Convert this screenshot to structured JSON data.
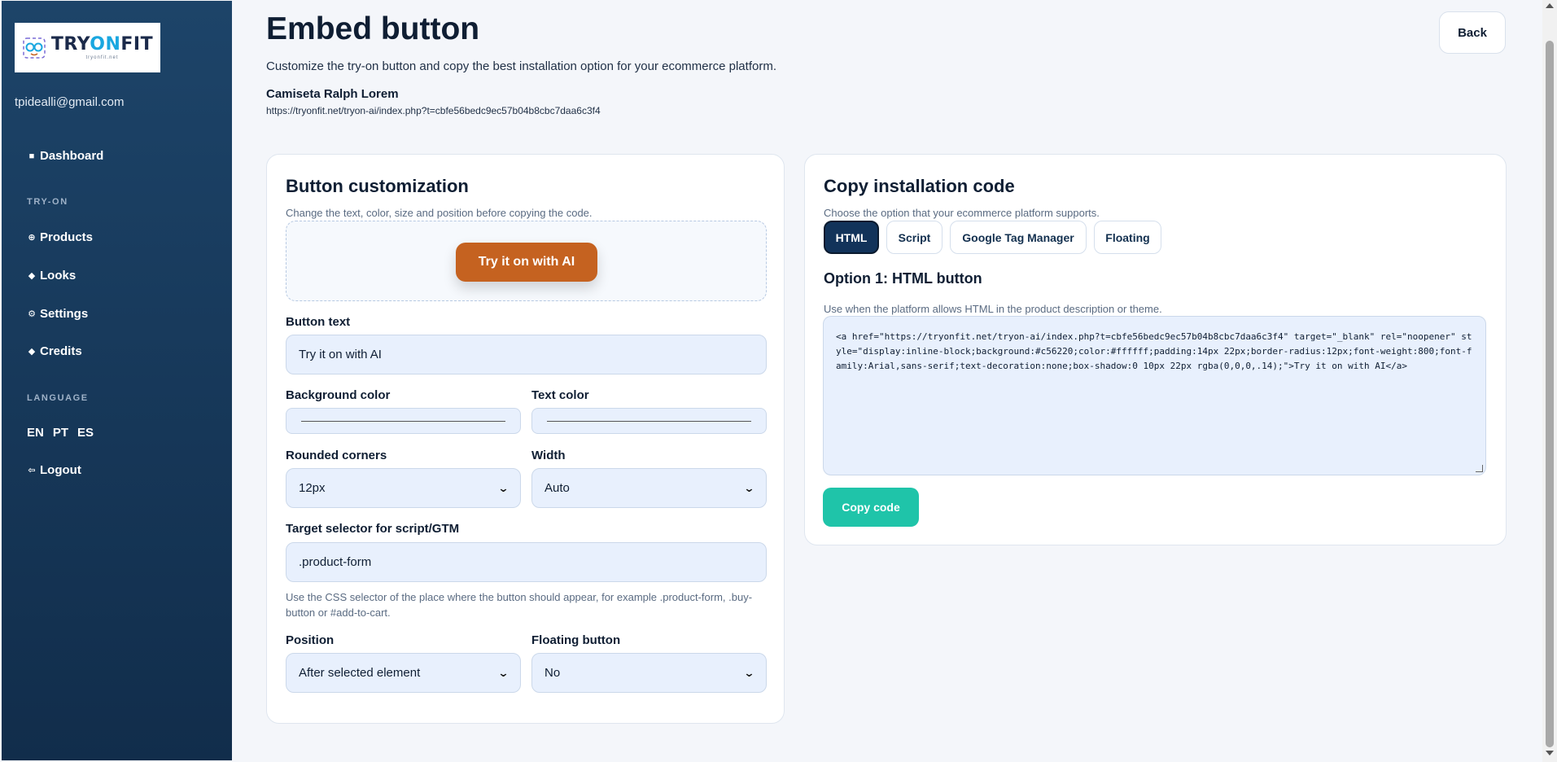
{
  "sidebar": {
    "logo": {
      "brand_part1": "TRY",
      "brand_part2": "ON",
      "brand_part3": "FIT",
      "tagline": "tryonfit.net"
    },
    "email": "tpidealli@gmail.com",
    "dashboard": {
      "icon": "■",
      "label": "Dashboard"
    },
    "tryon_section": "TRY-ON",
    "items": [
      {
        "icon": "⊕",
        "label": "Products"
      },
      {
        "icon": "◆",
        "label": "Looks"
      },
      {
        "icon": "⚙",
        "label": "Settings"
      },
      {
        "icon": "◆",
        "label": "Credits"
      }
    ],
    "language_section": "LANGUAGE",
    "languages": [
      "EN",
      "PT",
      "ES"
    ],
    "logout": {
      "icon": "⇦",
      "label": "Logout"
    }
  },
  "header": {
    "title": "Embed button",
    "subtitle": "Customize the try-on button and copy the best installation option for your ecommerce platform.",
    "product_name": "Camiseta Ralph Lorem",
    "product_url": "https://tryonfit.net/tryon-ai/index.php?t=cbfe56bedc9ec57b04b8cbc7daa6c3f4",
    "back_label": "Back"
  },
  "customization": {
    "title": "Button customization",
    "hint": "Change the text, color, size and position before copying the code.",
    "preview_button": "Try it on with AI",
    "button_text_label": "Button text",
    "button_text_value": "Try it on with AI",
    "bg_color_label": "Background color",
    "text_color_label": "Text color",
    "rounded_label": "Rounded corners",
    "rounded_value": "12px",
    "width_label": "Width",
    "width_value": "Auto",
    "selector_label": "Target selector for script/GTM",
    "selector_value": ".product-form",
    "selector_help": "Use the CSS selector of the place where the button should appear, for example .product-form, .buy-button or #add-to-cart.",
    "position_label": "Position",
    "position_value": "After selected element",
    "floating_label": "Floating button",
    "floating_value": "No"
  },
  "install": {
    "title": "Copy installation code",
    "hint": "Choose the option that your ecommerce platform supports.",
    "tabs": [
      "HTML",
      "Script",
      "Google Tag Manager",
      "Floating"
    ],
    "active_tab": "HTML",
    "option_title": "Option 1: HTML button",
    "option_hint": "Use when the platform allows HTML in the product description or theme.",
    "code": "<a href=\"https://tryonfit.net/tryon-ai/index.php?t=cbfe56bedc9ec57b04b8cbc7daa6c3f4\" target=\"_blank\" rel=\"noopener\" style=\"display:inline-block;background:#c56220;color:#ffffff;padding:14px 22px;border-radius:12px;font-weight:800;font-family:Arial,sans-serif;text-decoration:none;box-shadow:0 10px 22px rgba(0,0,0,.14);\">Try it on with AI</a>",
    "copy_label": "Copy code"
  },
  "colors": {
    "sidebar_top": "#1d4469",
    "sidebar_bottom": "#112d4b",
    "button_bg": "#c56220",
    "button_text": "#ffffff",
    "copy_button": "#1fc4a9",
    "active_tab": "#12335a"
  }
}
